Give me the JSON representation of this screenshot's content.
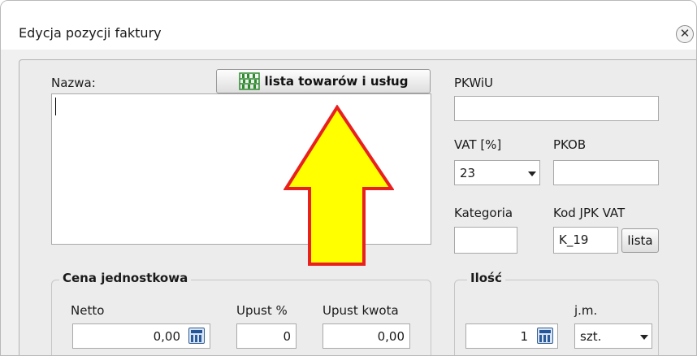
{
  "window": {
    "title": "Edycja pozycji faktury",
    "close_glyph": "✕"
  },
  "name_field": {
    "label": "Nazwa:",
    "value": ""
  },
  "goods_list_button": {
    "label": "lista towarów i usług",
    "icon": "shelves-icon"
  },
  "pkwiu": {
    "label": "PKWiU",
    "value": ""
  },
  "vat": {
    "label": "VAT [%]",
    "value": "23"
  },
  "pkob": {
    "label": "PKOB",
    "value": ""
  },
  "kategoria": {
    "label": "Kategoria",
    "value": ""
  },
  "kod_jpk": {
    "label": "Kod JPK VAT",
    "value": "K_19",
    "button_label": "lista"
  },
  "cena_group": {
    "title": "Cena jednostkowa",
    "netto_label": "Netto",
    "netto_value": "0,00",
    "upust_pct_label": "Upust %",
    "upust_pct_value": "0",
    "upust_kwota_label": "Upust kwota",
    "upust_kwota_value": "0,00"
  },
  "ilosc_group": {
    "title": "Ilość",
    "qty_value": "1",
    "unit_label": "j.m.",
    "unit_value": "szt."
  },
  "annotation": {
    "type": "arrow",
    "fill": "#ffff00",
    "stroke": "#e82020",
    "icon": "up-arrow-icon"
  },
  "colors": {
    "icon_green": "#2e8b2e",
    "calc_blue": "#245598"
  }
}
